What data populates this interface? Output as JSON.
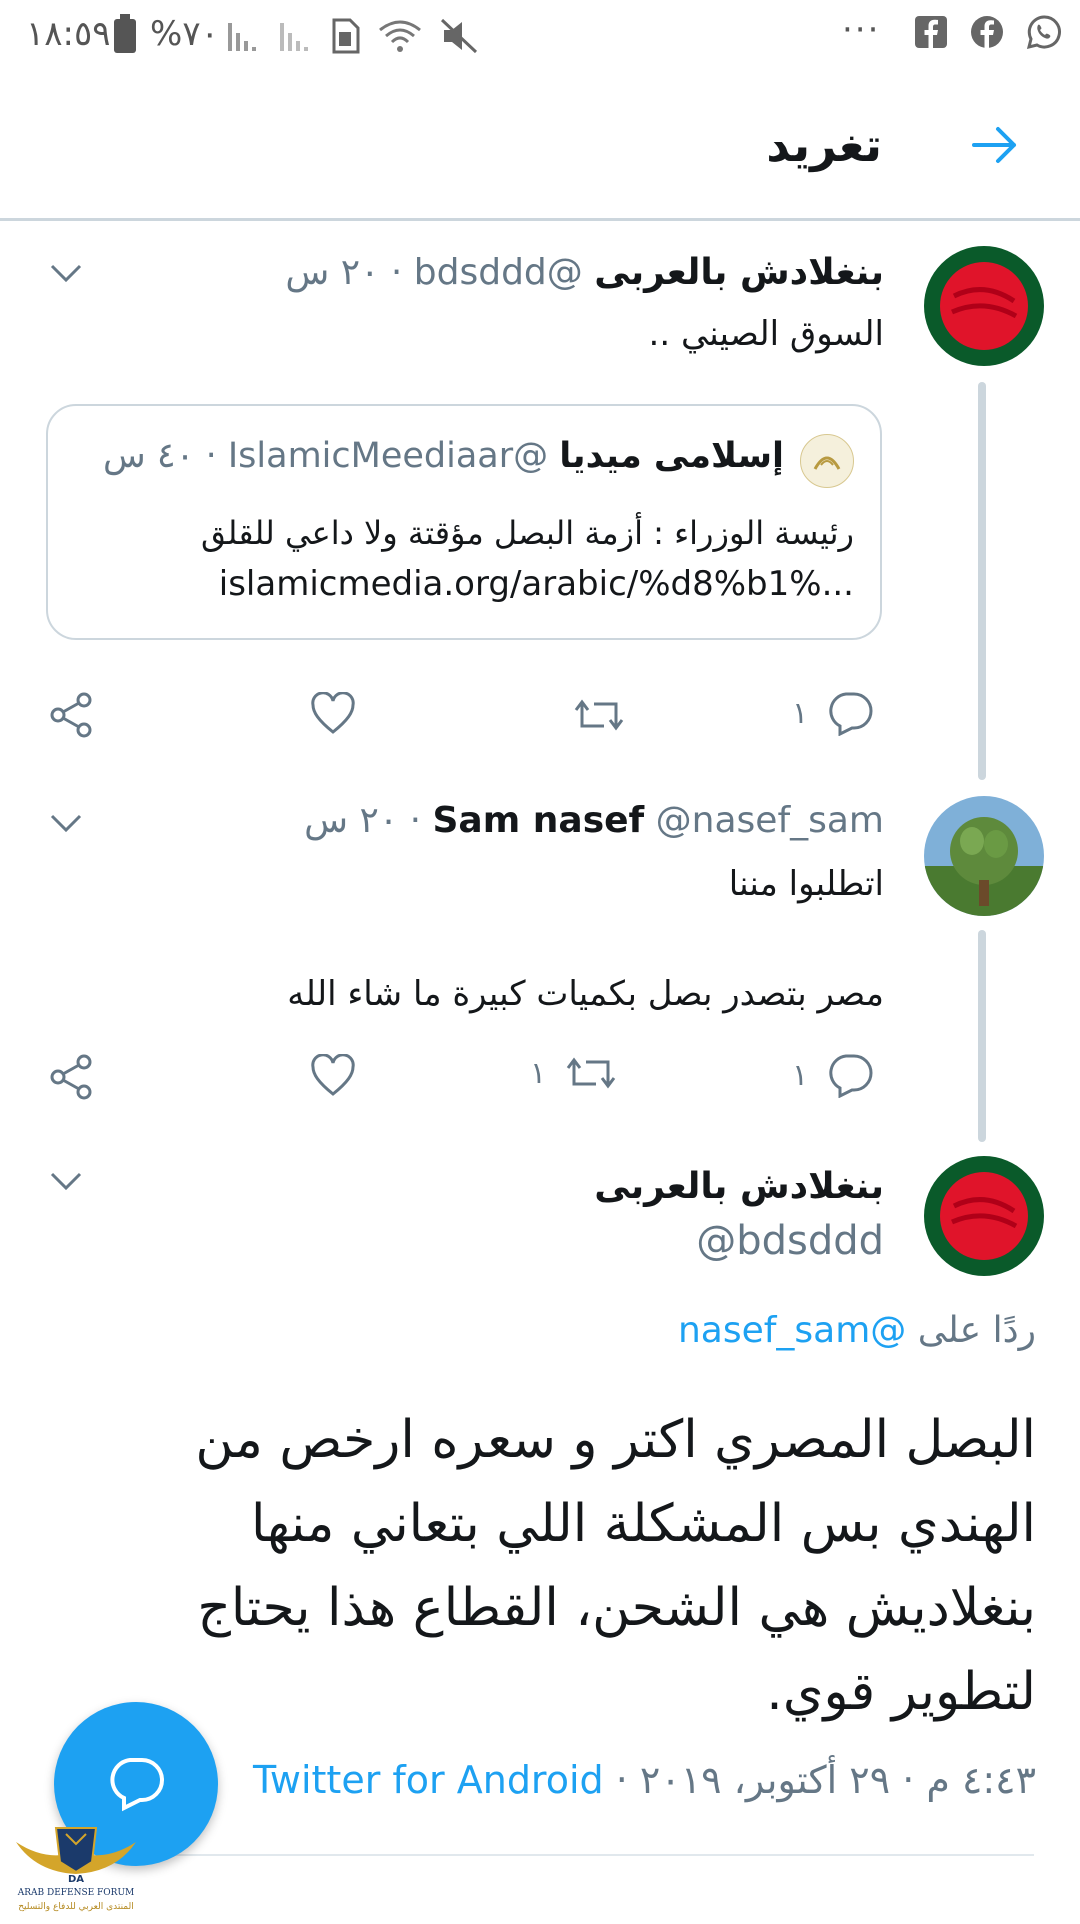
{
  "status_bar": {
    "time": "١٨:٥٩",
    "battery": "%٧٠",
    "more": "···"
  },
  "header": {
    "title": "تغريد"
  },
  "tweets": [
    {
      "name": "بنغلادش بالعربى",
      "handle": "@bdsddd",
      "time": "· ٢٠ س",
      "text": "السوق الصيني ..",
      "quote": {
        "name": "إسلامى ميديا",
        "handle": "@IslamicMeediaar",
        "time": "· ٤٠ س",
        "line1": "رئيسة الوزراء : أزمة البصل مؤقتة ولا داعي للقلق",
        "line2": "islamicmedia.org/arabic/%d8%b1%..."
      },
      "reply_count": "١",
      "retweet_count": "",
      "like_count": ""
    },
    {
      "name": "Sam nasef",
      "handle": "@nasef_sam",
      "time": "· ٢٠ س",
      "text1": "اتطلبوا مننا",
      "text2": "مصر بتصدر بصل بكميات كبيرة ما شاء الله",
      "reply_count": "١",
      "retweet_count": "١",
      "like_count": ""
    }
  ],
  "main_tweet": {
    "name": "بنغلادش بالعربى",
    "handle": "@bdsddd",
    "reply_to_prefix": "ردًا على",
    "reply_to_handle": "@nasef_sam",
    "text_lines": [
      "البصل المصري اكتر و سعره ارخص من",
      "الهندي بس المشكلة اللي بتعاني منها",
      "بنغلاديش هي الشحن، القطاع هذا يحتاج",
      "لتطوير قوي."
    ],
    "timestamp": "٤:٤٣ م · ٢٩ أكتوبر، ٢٠١٩ ·",
    "source": "Twitter for Android"
  },
  "watermark": {
    "name": "ARAB DEFENSE FORUM",
    "name_ar": "المنتدى العربي للدفاع والتسليح",
    "abbr": "DA"
  },
  "colors": {
    "accent": "#1da1f2",
    "muted": "#657786",
    "text": "#14171a",
    "border": "#ccd6dd"
  },
  "icons": [
    "facebook-square-icon",
    "facebook-icon",
    "whatsapp-icon",
    "mute-icon",
    "wifi-icon",
    "sim-icon",
    "signal-icon",
    "battery-icon",
    "arrow-icon",
    "chevron-down-icon",
    "share-icon",
    "heart-icon",
    "retweet-icon",
    "reply-icon",
    "compose-reply-icon"
  ]
}
